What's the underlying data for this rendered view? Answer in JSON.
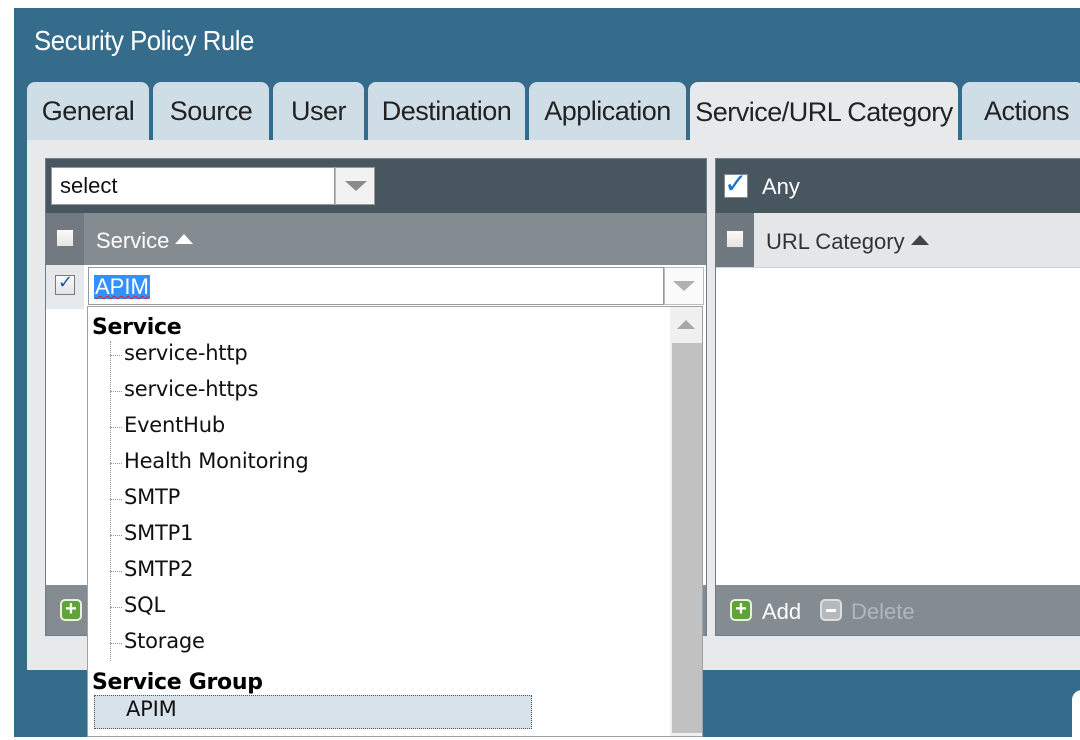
{
  "dialog": {
    "title": "Security Policy Rule"
  },
  "tabs": [
    {
      "label": "General"
    },
    {
      "label": "Source"
    },
    {
      "label": "User"
    },
    {
      "label": "Destination"
    },
    {
      "label": "Application"
    },
    {
      "label": "Service/URL Category",
      "active": true
    },
    {
      "label": "Actions"
    }
  ],
  "service_panel": {
    "select_value": "select",
    "column_header": "Service",
    "row_value": "APIM",
    "row_checked": true
  },
  "dropdown": {
    "groups": [
      {
        "label": "Service",
        "items": [
          "service-http",
          "service-https",
          "EventHub",
          "Health Monitoring",
          "SMTP",
          "SMTP1",
          "SMTP2",
          "SQL",
          "Storage"
        ]
      },
      {
        "label": "Service Group",
        "items": [
          "APIM"
        ],
        "selected": "APIM"
      }
    ]
  },
  "url_panel": {
    "any_label": "Any",
    "any_checked": true,
    "column_header": "URL Category",
    "add_label": "Add",
    "delete_label": "Delete"
  },
  "colors": {
    "dialog_bg": "#356b8b",
    "tab_bg": "#cfdee6",
    "toolbar_bg": "#48575f",
    "header_bg": "#848b91",
    "selection": "#3390ff"
  },
  "icons": [
    "chevron-down-icon",
    "sort-asc-icon",
    "checkmark-icon",
    "add-icon",
    "delete-icon",
    "scroll-up-icon"
  ]
}
